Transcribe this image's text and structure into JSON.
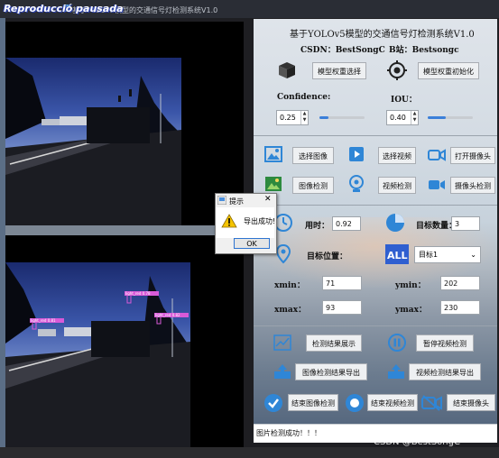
{
  "window": {
    "title": "基于YOLOv5模型的交通信号灯检测系统V1.0",
    "overlay_label": "Reproducció pausada"
  },
  "video": {
    "top_detections": [],
    "bottom_detections": [
      {
        "label": "light_red 0.78"
      },
      {
        "label": "light_red 0.81"
      },
      {
        "label": "light_red 0.82"
      }
    ]
  },
  "header": {
    "title": "基于YOLOv5模型的交通信号灯检测系统V1.0",
    "csdn": "CSDN：BestSongC",
    "bilibili": "B站：Bestsongc"
  },
  "model": {
    "select_weights_label": "模型权重选择",
    "init_weights_label": "模型权重初始化"
  },
  "thresholds": {
    "confidence_label": "Confidence:",
    "confidence_value": "0.25",
    "confidence_fraction": 0.2,
    "iou_label": "IOU：",
    "iou_value": "0.40",
    "iou_fraction": 0.4
  },
  "sources": {
    "select_image_label": "选择图像",
    "select_video_label": "选择视频",
    "open_camera_label": "打开摄像头",
    "image_detect_label": "图像检测",
    "video_detect_label": "视频检测",
    "camera_detect_label": "摄像头检测"
  },
  "stats": {
    "time_label": "用时：",
    "time_value": "0.92",
    "count_label": "目标数量：",
    "count_value": "3",
    "position_label": "目标位置：",
    "target_select_value": "目标1"
  },
  "bbox": {
    "xmin_label": "xmin：",
    "xmin_value": "71",
    "ymin_label": "ymin：",
    "ymin_value": "202",
    "xmax_label": "xmax：",
    "xmax_value": "93",
    "ymax_label": "ymax：",
    "ymax_value": "230"
  },
  "actions": {
    "show_results_label": "检测结果展示",
    "pause_video_label": "暂停视频检测",
    "export_image_label": "图像检测结果导出",
    "export_video_label": "视频检测结果导出",
    "end_image_label": "结束图像检测",
    "end_video_label": "结束视频检测",
    "end_camera_label": "结束摄像头"
  },
  "status": {
    "message": "图片检测成功！！！"
  },
  "dialog": {
    "title": "提示",
    "message": "导出成功!",
    "ok_label": "OK",
    "close_glyph": "✕"
  },
  "watermark": "CSDN @BestSongC",
  "colors": {
    "accent_blue": "#3b7fd9",
    "detection_box": "#d85ad8",
    "icon_blue": "#2f86d6"
  }
}
